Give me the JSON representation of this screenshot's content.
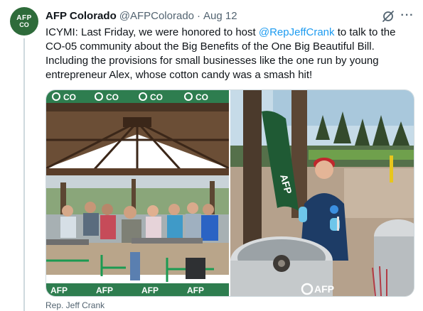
{
  "tweet": {
    "display_name": "AFP Colorado",
    "handle": "@AFPColorado",
    "separator": "·",
    "date": "Aug 12",
    "text_before": "ICYMI: Last Friday, we were honored to host ",
    "mention": "@RepJeffCrank",
    "text_after": " to talk to the CO-05 community about the Big Benefits of the One Big Beautiful Bill. Including the provisions for small businesses like the one run by young entrepreneur Alex, whose cotton candy was a smash hit!"
  },
  "avatar": {
    "line1": "AFP",
    "line2": "CO",
    "color": "#2e6b3a"
  },
  "icons": {
    "grok": "grok-icon",
    "more": "more-icon"
  },
  "more_label": "···",
  "media": {
    "left_photo": {
      "banner_text": "CO",
      "footer_text": "AFP"
    },
    "right_photo": {
      "flag_text": "AFP",
      "logo_text": "AFP"
    }
  },
  "caption": "Rep. Jeff Crank",
  "colors": {
    "link": "#1d9bf0",
    "secondary_text": "#536471",
    "afp_green": "#2e6b3a"
  }
}
